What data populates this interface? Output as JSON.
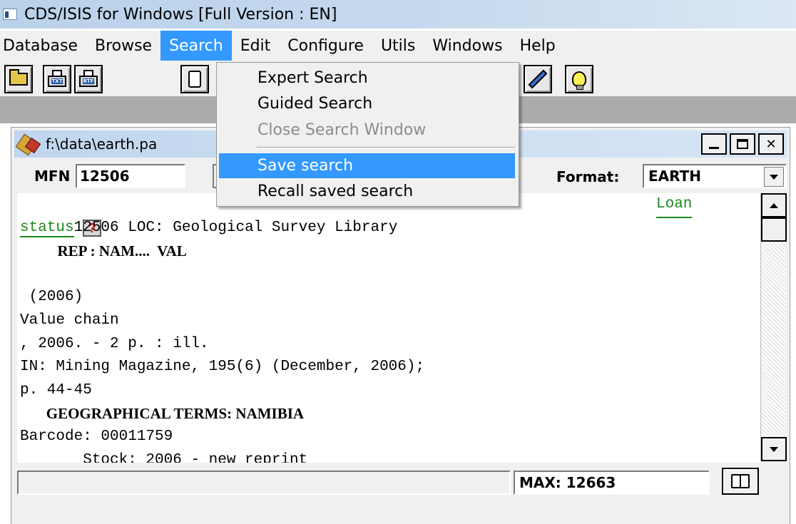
{
  "app": {
    "title": "CDS/ISIS for Windows [Full Version : EN]"
  },
  "menubar": {
    "items": [
      "Database",
      "Browse",
      "Search",
      "Edit",
      "Configure",
      "Utils",
      "Windows",
      "Help"
    ],
    "open_menu": "Search"
  },
  "toolbar": {
    "buttons": [
      "open-folder-icon",
      "print-txt-icon",
      "print-rtf-icon",
      "clipboard-icon",
      "pencil-icon",
      "lightbulb-icon"
    ],
    "print_txt_tag": "TXT",
    "print_rtf_tag": "RTF"
  },
  "search_menu": {
    "items": [
      {
        "label": "Expert Search",
        "state": "enabled"
      },
      {
        "label": "Guided Search",
        "state": "enabled"
      },
      {
        "label": "Close Search Window",
        "state": "disabled"
      },
      {
        "label": "Save search",
        "state": "highlighted"
      },
      {
        "label": "Recall saved search",
        "state": "enabled"
      }
    ]
  },
  "child_window": {
    "title": "f:\\data\\earth.pa",
    "mfn_label": "MFN",
    "mfn_value": "12506",
    "format_label": "Format:",
    "format_value": "EARTH",
    "record": {
      "line1_text": "12506 LOC: Geological Survey Library",
      "loan_link_1": "Loan",
      "loan_link_2": "status",
      "help_button": "?",
      "rep_line": "          REP : NAM....  VAL",
      "blank": "",
      "year": " (2006)",
      "title": "Value chain",
      "pages": ", 2006. - 2 p. : ill.",
      "source": "IN: Mining Magazine, 195(6) (December, 2006);",
      "pp": "p. 44-45",
      "geo_terms": "       GEOGRAPHICAL TERMS: NAMIBIA",
      "barcode": "Barcode: 00011759",
      "stock": "       Stock: 2006 - new reprint"
    },
    "status_text": "",
    "max_label": "MAX: 12663"
  },
  "colors": {
    "menu_highlight": "#3399ff",
    "link_green": "#1a8a1a",
    "title_bar": "#c6d9ee"
  }
}
